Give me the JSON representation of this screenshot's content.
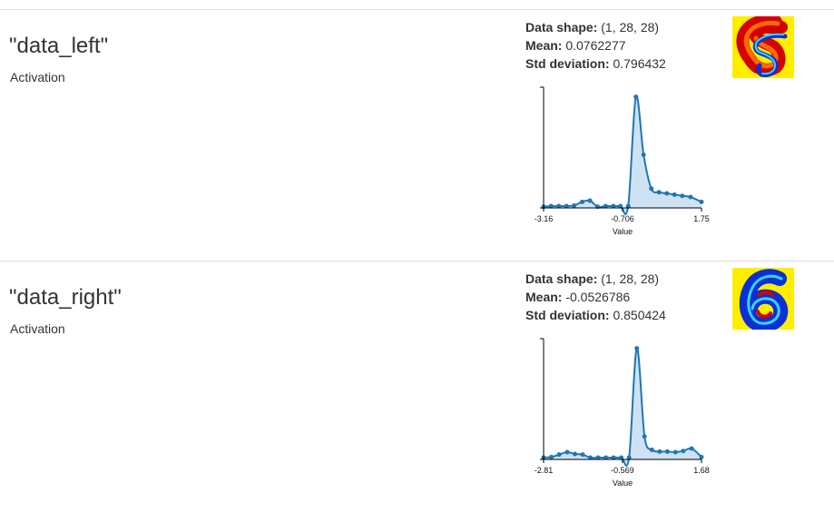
{
  "layers": [
    {
      "name": "\"data_left\"",
      "type": "Activation",
      "stats": {
        "shape_label": "Data shape:",
        "shape_value": "(1, 28, 28)",
        "mean_label": "Mean:",
        "mean_value": "0.0762277",
        "std_label": "Std deviation:",
        "std_value": "0.796432"
      },
      "chart_data": {
        "type": "area",
        "xlabel": "Value",
        "xticks": [
          "-3.16",
          "-0.706",
          "1.75"
        ],
        "xlim": [
          -3.16,
          1.75
        ],
        "ylim": [
          0,
          1
        ],
        "points": [
          [
            -3.16,
            0.01
          ],
          [
            -2.93,
            0.015
          ],
          [
            -2.69,
            0.015
          ],
          [
            -2.45,
            0.015
          ],
          [
            -2.21,
            0.02
          ],
          [
            -1.96,
            0.05
          ],
          [
            -1.72,
            0.06
          ],
          [
            -1.48,
            0.01
          ],
          [
            -1.23,
            0.015
          ],
          [
            -0.99,
            0.015
          ],
          [
            -0.77,
            0.015
          ],
          [
            -0.53,
            0.015
          ],
          [
            -0.29,
            0.92
          ],
          [
            -0.05,
            0.44
          ],
          [
            0.19,
            0.16
          ],
          [
            0.43,
            0.13
          ],
          [
            0.67,
            0.12
          ],
          [
            0.91,
            0.11
          ],
          [
            1.15,
            0.1
          ],
          [
            1.41,
            0.09
          ],
          [
            1.75,
            0.05
          ]
        ]
      },
      "image": {
        "glyph": "5",
        "colormap": "jet"
      }
    },
    {
      "name": "\"data_right\"",
      "type": "Activation",
      "stats": {
        "shape_label": "Data shape:",
        "shape_value": "(1, 28, 28)",
        "mean_label": "Mean:",
        "mean_value": "-0.0526786",
        "std_label": "Std deviation:",
        "std_value": "0.850424"
      },
      "chart_data": {
        "type": "area",
        "xlabel": "Value",
        "xticks": [
          "-2.81",
          "-0.569",
          "1.68"
        ],
        "xlim": [
          -2.81,
          1.68
        ],
        "ylim": [
          0,
          1
        ],
        "points": [
          [
            -2.81,
            0.015
          ],
          [
            -2.59,
            0.02
          ],
          [
            -2.37,
            0.04
          ],
          [
            -2.14,
            0.06
          ],
          [
            -1.92,
            0.045
          ],
          [
            -1.7,
            0.04
          ],
          [
            -1.48,
            0.015
          ],
          [
            -1.26,
            0.015
          ],
          [
            -1.04,
            0.015
          ],
          [
            -0.82,
            0.015
          ],
          [
            -0.6,
            0.015
          ],
          [
            -0.38,
            0.015
          ],
          [
            -0.16,
            0.92
          ],
          [
            0.06,
            0.19
          ],
          [
            0.27,
            0.08
          ],
          [
            0.49,
            0.065
          ],
          [
            0.71,
            0.065
          ],
          [
            0.94,
            0.06
          ],
          [
            1.16,
            0.07
          ],
          [
            1.4,
            0.09
          ],
          [
            1.68,
            0.02
          ]
        ]
      },
      "image": {
        "glyph": "6",
        "colormap": "jet"
      }
    }
  ],
  "colors": {
    "line": "#1f77b4",
    "fill": "#cfe2f3",
    "divider": "#dddddd",
    "thumb_background": "#ffee00"
  }
}
